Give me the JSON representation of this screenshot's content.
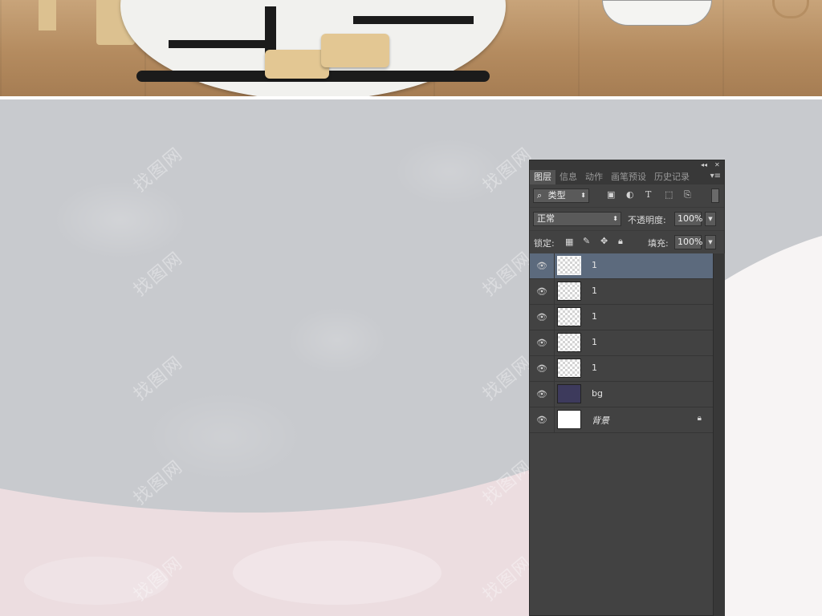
{
  "panel": {
    "top_controls": [
      "◂◂",
      "✕"
    ],
    "tabs": [
      {
        "label": "图层",
        "active": true
      },
      {
        "label": "信息",
        "active": false
      },
      {
        "label": "动作",
        "active": false
      },
      {
        "label": "画笔预设",
        "active": false
      },
      {
        "label": "历史记录",
        "active": false
      }
    ],
    "menu_icon": "▾≡",
    "filter": {
      "search_icon": "⌕",
      "label": "类型",
      "arrows": "⬍"
    },
    "filter_icons": [
      "image-icon",
      "adjustment-icon",
      "type-icon",
      "shape-icon",
      "smart-object-icon"
    ],
    "blend": {
      "mode": "正常",
      "opacity_label": "不透明度:",
      "opacity_value": "100%"
    },
    "lock": {
      "label": "锁定:",
      "fill_label": "填充:",
      "fill_value": "100%"
    },
    "layers": [
      {
        "name": "1",
        "selected": true,
        "thumb": "transparent"
      },
      {
        "name": "1",
        "selected": false,
        "thumb": "transparent"
      },
      {
        "name": "1",
        "selected": false,
        "thumb": "transparent"
      },
      {
        "name": "1",
        "selected": false,
        "thumb": "transparent"
      },
      {
        "name": "1",
        "selected": false,
        "thumb": "transparent"
      },
      {
        "name": "bg",
        "selected": false,
        "thumb": "dark"
      },
      {
        "name": "背景",
        "selected": false,
        "thumb": "white",
        "locked": true
      }
    ]
  },
  "watermark": "找图网",
  "colors": {
    "panel_bg": "#424242",
    "selected_layer": "#5c6a7d",
    "canvas_gray": "#c8cace",
    "canvas_pink": "#ecdde0"
  }
}
